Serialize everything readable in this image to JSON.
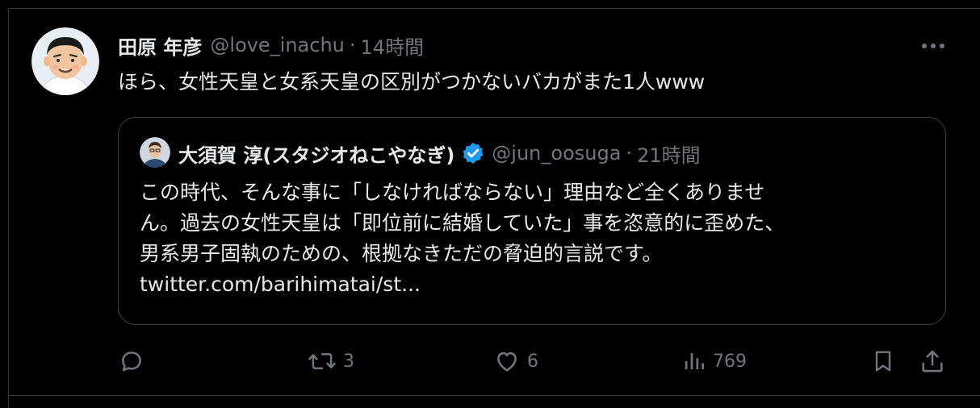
{
  "tweet": {
    "author_name": "田原 年彦",
    "handle": "@love_inachu",
    "separator": "·",
    "time": "14時間",
    "text": "ほら、女性天皇と女系天皇の区別がつかないバカがまた1人www"
  },
  "quote": {
    "author_name": "大須賀 淳(スタジオねこやなぎ)",
    "handle": "@jun_oosuga",
    "separator": "·",
    "time": "21時間",
    "lines": [
      "この時代、そんな事に「しなければならない」理由など全くありませ",
      "ん。過去の女性天皇は「即位前に結婚していた」事を恣意的に歪めた、",
      "男系男子固執のための、根拠なきただの脅迫的言説です。",
      "twitter.com/barihimatai/st..."
    ]
  },
  "actions": {
    "reply_count": "",
    "retweet_count": "3",
    "like_count": "6",
    "views_count": "769"
  },
  "colors": {
    "background": "#000000",
    "text": "#e7e9ea",
    "muted": "#71767b",
    "verified": "#1d9bf0",
    "border": "#2f3336"
  },
  "icons": [
    "more-icon",
    "verified-badge-icon",
    "reply-icon",
    "retweet-icon",
    "like-icon",
    "views-icon",
    "bookmark-icon",
    "share-icon"
  ]
}
